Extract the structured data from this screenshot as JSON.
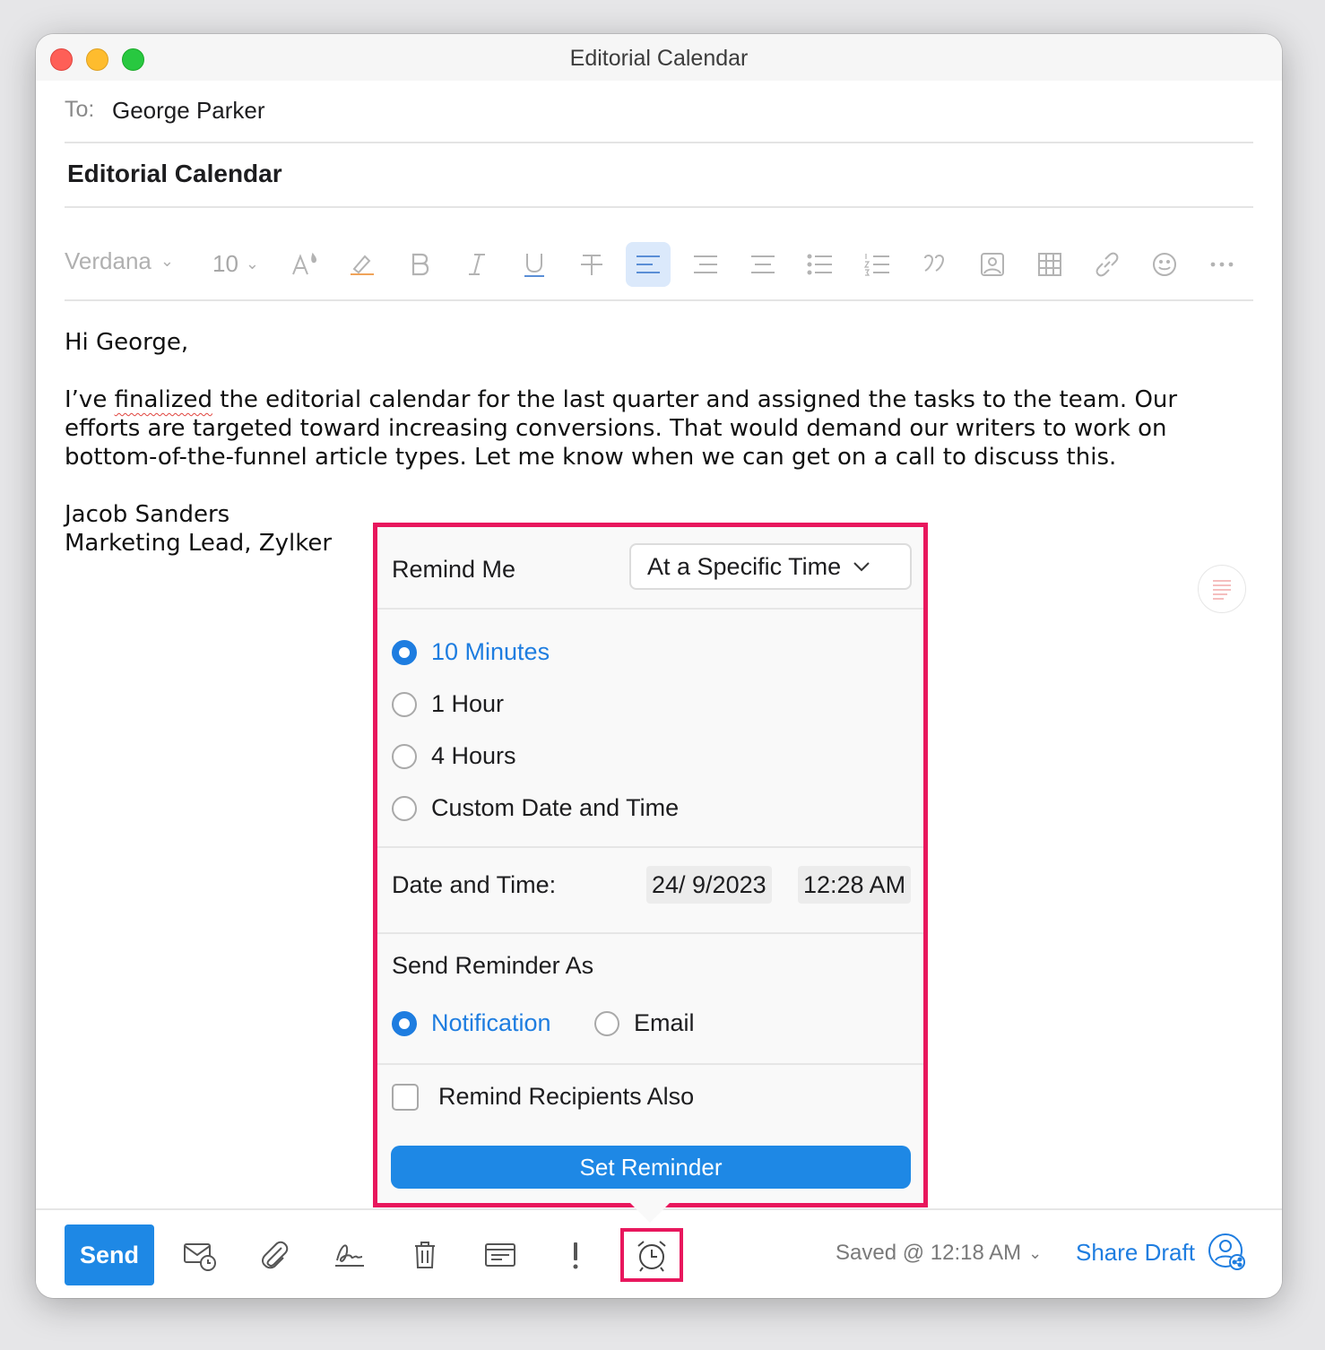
{
  "window": {
    "title": "Editorial Calendar"
  },
  "compose": {
    "to_label": "To:",
    "to_value": "George Parker",
    "subject": "Editorial Calendar"
  },
  "toolbar": {
    "font": "Verdana",
    "size": "10",
    "icons": [
      "font-size-icon",
      "highlight-icon",
      "bold-icon",
      "italic-icon",
      "underline-icon",
      "strikethrough-icon",
      "align-left-icon",
      "align-center-icon",
      "align-right-icon",
      "bullet-list-icon",
      "numbered-list-icon",
      "quote-icon",
      "image-icon",
      "table-icon",
      "link-icon",
      "emoji-icon",
      "more-icon"
    ]
  },
  "body": {
    "greeting": "Hi George,",
    "para_pre": "I’ve ",
    "para_misspelled": "finalized",
    "para_post": " the editorial calendar for the last quarter and assigned the tasks to the team. Our efforts are targeted toward increasing conversions. That would demand our writers to work on bottom-of-the-funnel article types. Let me know when we can get on a call to discuss this.",
    "sig_name": "Jacob Sanders",
    "sig_title": "Marketing Lead, Zylker"
  },
  "reminder": {
    "remind_me_label": "Remind Me",
    "remind_me_value": "At a Specific Time",
    "options": [
      {
        "label": "10 Minutes",
        "selected": true
      },
      {
        "label": "1 Hour",
        "selected": false
      },
      {
        "label": "4 Hours",
        "selected": false
      },
      {
        "label": "Custom Date and Time",
        "selected": false
      }
    ],
    "date_time_label": "Date and Time:",
    "date": "24/ 9/2023",
    "time": "12:28 AM",
    "send_as_label": "Send Reminder As",
    "send_as_options": [
      {
        "label": "Notification",
        "selected": true
      },
      {
        "label": "Email",
        "selected": false
      }
    ],
    "remind_recipients_label": "Remind Recipients Also",
    "set_button": "Set Reminder"
  },
  "bottom_bar": {
    "send_label": "Send",
    "saved_status": "Saved @ 12:18 AM",
    "share_draft": "Share Draft"
  },
  "colors": {
    "accent": "#1e88e5",
    "highlight_border": "#e8175d"
  }
}
